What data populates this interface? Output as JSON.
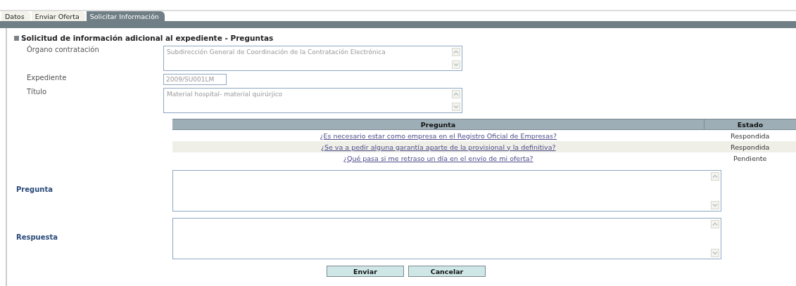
{
  "tabs": [
    {
      "label": "Datos",
      "selected": false
    },
    {
      "label": "Enviar Oferta",
      "selected": false
    },
    {
      "label": "Solicitar Información",
      "selected": true
    }
  ],
  "section_title": "Solicitud de información adicional al expediente - Preguntas",
  "fields": [
    {
      "kind": "textarea",
      "label": "Órgano contratación",
      "value": "Subdirección General de Coordinación de la Contratación Electrónica"
    },
    {
      "kind": "input",
      "label": "Expediente",
      "value": "2009/SU001LM"
    },
    {
      "kind": "textarea",
      "label": "Título",
      "value": "Material hospital- material quirúrjico"
    }
  ],
  "table": {
    "columns": [
      "Pregunta",
      "Estado"
    ],
    "rows": [
      {
        "pregunta": "¿Es necesario estar como empresa en el Registro Oficial de Empresas?",
        "estado": "Respondida"
      },
      {
        "pregunta": "¿Se va a pedir alguna garantía aparte de la provisional y la definitiva?",
        "estado": "Respondida"
      },
      {
        "pregunta": "¿Qué pasa si me retraso un día en el envío de mi oferta?",
        "estado": "Pendiente"
      }
    ]
  },
  "editors": [
    {
      "label": "Pregunta"
    },
    {
      "label": "Respuesta"
    }
  ],
  "buttons": [
    "Enviar",
    "Cancelar"
  ]
}
